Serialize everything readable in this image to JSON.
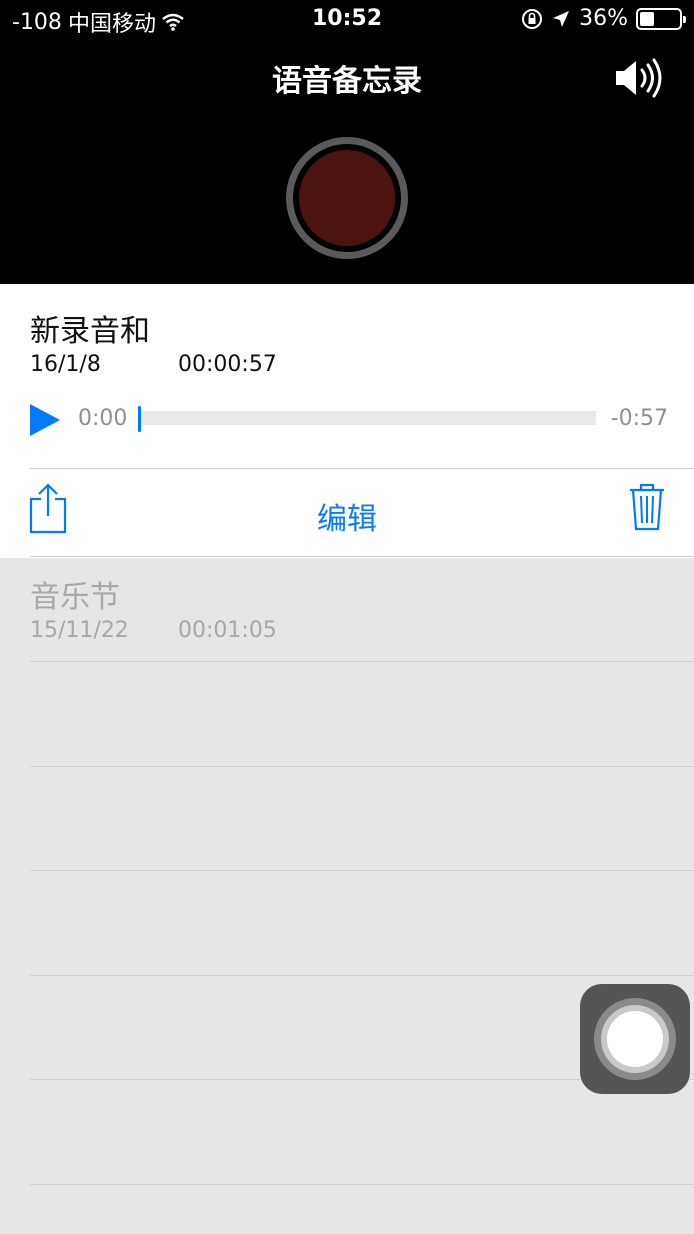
{
  "status_bar": {
    "signal": "-108",
    "carrier": "中国移动",
    "time": "10:52",
    "battery_percent_label": "36%",
    "battery_level": 0.36,
    "icons": [
      "wifi-icon",
      "rotation-lock-icon",
      "location-arrow-icon",
      "battery-icon"
    ]
  },
  "header": {
    "title": "语音备忘录",
    "speaker_icon": "speaker-icon",
    "record_icon": "record-button-icon"
  },
  "selected_recording": {
    "name": "新录音和",
    "date": "16/1/8",
    "duration": "00:00:57",
    "elapsed": "0:00",
    "remaining": "-0:57",
    "progress": 0.0,
    "edit_label": "编辑",
    "icons": [
      "play-icon",
      "share-icon",
      "trash-icon"
    ]
  },
  "recordings": [
    {
      "name": "音乐节",
      "date": "15/11/22",
      "duration": "00:01:05"
    }
  ],
  "colors": {
    "accent": "#007aff",
    "record": "#4d1310",
    "header_bg": "#000000",
    "list_bg": "#e6e6e6"
  }
}
